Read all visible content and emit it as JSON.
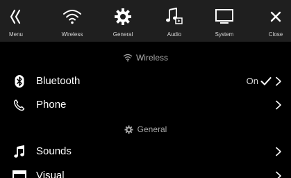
{
  "topbar": {
    "items": [
      {
        "label": "Menu",
        "icon": "double-chevron-left-icon"
      },
      {
        "label": "Wireless",
        "icon": "wifi-icon"
      },
      {
        "label": "General",
        "icon": "gear-icon"
      },
      {
        "label": "Audio",
        "icon": "music-note-icon"
      },
      {
        "label": "System",
        "icon": "monitor-icon"
      },
      {
        "label": "Close",
        "icon": "close-icon"
      }
    ]
  },
  "sections": {
    "wireless": {
      "title": "Wireless",
      "icon": "wifi-icon"
    },
    "general": {
      "title": "General",
      "icon": "gear-icon"
    }
  },
  "rows": {
    "bluetooth": {
      "label": "Bluetooth",
      "value": "On",
      "icon": "bluetooth-icon"
    },
    "phone": {
      "label": "Phone",
      "icon": "phone-icon"
    },
    "sounds": {
      "label": "Sounds",
      "icon": "music-note-icon"
    },
    "visual": {
      "label": "Visual",
      "icon": "display-icon"
    }
  },
  "colors": {
    "background": "#000000",
    "topbar": "#1f1f1f",
    "text": "#ffffff",
    "muted": "#a9a9a9"
  }
}
